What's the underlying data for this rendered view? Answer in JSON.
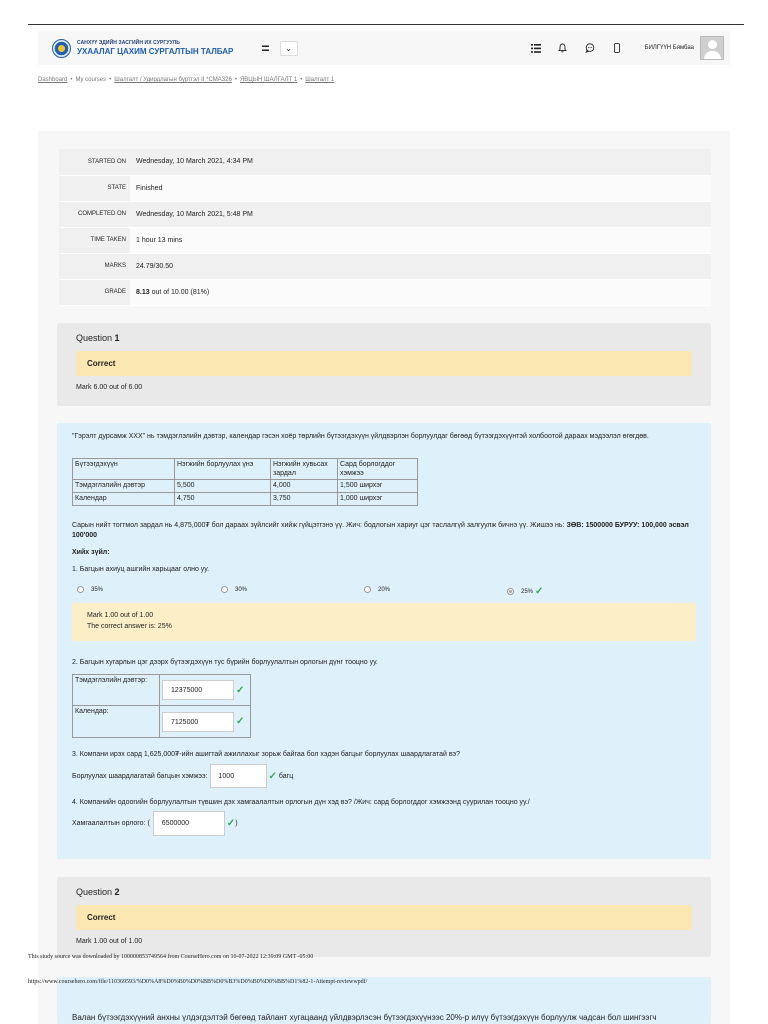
{
  "navbar": {
    "logo_line1": "САНХҮҮ ЭДИЙН ЗАСГИЙН ИХ СУРГУУЛЬ",
    "logo_line2": "УХААЛАГ ЦАХИМ СУРГАЛТЫН ТАЛБАР",
    "menu_symbol": "=",
    "dropdown_symbol": "⌄",
    "user_name": "БИЛГҮҮН Бямбаа"
  },
  "breadcrumb": {
    "items": [
      "Dashboard",
      "My courses",
      "Шалгалт / Удирдлагын бүртгэл II *CMA326",
      "ЯВЦЫН ШАЛГАЛТ 1",
      "Шалгалт 1"
    ],
    "separator": "•"
  },
  "summary": [
    {
      "label": "STARTED ON",
      "value": "Wednesday, 10 March 2021, 4:34 PM"
    },
    {
      "label": "STATE",
      "value": "Finished"
    },
    {
      "label": "COMPLETED ON",
      "value": "Wednesday, 10 March 2021, 5:48 PM"
    },
    {
      "label": "TIME TAKEN",
      "value": "1 hour 13 mins"
    },
    {
      "label": "MARKS",
      "value": "24.79/30.50"
    },
    {
      "label": "GRADE",
      "value_bold": "8.13",
      "value_rest": " out of 10.00 (81%)"
    }
  ],
  "question1": {
    "title_prefix": "Question ",
    "number": "1",
    "state": "Correct",
    "mark": "Mark 6.00 out of 6.00",
    "prompt": "\"Гэрэлт дурсамж XXX\" нь тэмдэглэлийн дэвтэр, календар гэсэн хоёр төрлийн бүтээгдэхүүн үйлдвэрлэн борлуулдаг бөгөөд бүтээгдэхүүнтэй холбоотой дараах мэдээлэл өгөгдөв.",
    "table": {
      "headers": [
        "Бүтээгдэхүүн",
        "Нэгжийн борлуулах үнэ",
        "Нэгжийн хувьсах зардал",
        "Сард борлогддог хэмжээ"
      ],
      "rows": [
        [
          "Тэмдэглэлийн дэвтэр",
          "5,500",
          "4,000",
          "1,500 ширхэг"
        ],
        [
          "Календар",
          "4,750",
          "3,750",
          "1,000 ширхэг"
        ]
      ]
    },
    "note_part1": "Сарын нийт тогтмол зардал нь 4,875,000₮ бол дараах зүйлсийг хийж гүйцэтгэнэ үү. Жич: бодлогын хариуг цэг таслалгүй залгуулж бичнэ үү. Жишээ нь: ",
    "note_bold": "ЗӨВ: 1500000 БУРУУ: 100,000 эсвэл 100'000",
    "instructions": "Хийх зүйл:",
    "sub1": "1.    Багцын ахиуц ашгийн харьцааг олно уу.",
    "options": [
      "35%",
      "30%",
      "20%",
      "25%"
    ],
    "feedback_mark": "Mark 1.00 out of 1.00",
    "feedback_answer": "The correct answer is: 25%",
    "sub2": "2.    Багцын хугарлын цэг дээрх бүтээгдэхүүн тус бүрийн борлуулалтын орлогын дүнг тооцно уу.",
    "answers2": [
      {
        "label": "Тэмдэглэлийн дэвтэр:",
        "value": "12375000"
      },
      {
        "label": "Календар:",
        "value": "7125000"
      }
    ],
    "sub3": "3.    Компани ирэх сард 1,625,000₮-ийн ашигтай ажиллахыг зорьж байгаа бол хэдэн багцыг борлуулах шаардлагатай вэ?",
    "row3_label": "Борлуулах шаардлагатай багцын хэмжээ:",
    "row3_value": "1000",
    "row3_suffix": "багц",
    "sub4": "4.    Компанийн одоогийн борлуулалтын түвшин дэх  хамгаалалтын орлогын дүн хэд вэ? /Жич: сард борлогддог хэмжээнд суурилан тооцно уу./",
    "row4_label": "Хамгаалалтын орлого: (",
    "row4_value": "6500000",
    "row4_suffix": ")"
  },
  "question2": {
    "title_prefix": "Question ",
    "number": "2",
    "state": "Correct",
    "mark": "Mark 1.00 out of 1.00"
  },
  "footer": {
    "source_line": "This study source was downloaded by 100000853749564 from CourseHero.com on 10-07-2022 12:39:09 GMT -05:00",
    "url_line": "https://www.coursehero.com/file/110369593/%D0%A8%D0%B0%D0%BB%D0%B3%D0%B0%D0%BB%D1%82-1-Attempt-reviewwpdf/",
    "next_text": "Валан бүтээгдэхүүний анхны үлдэгдэлтэй бөгөөд тайлант хугацаанд үйлдвэрлэсэн бүтээгдэхүүнээс 20%-р илүү бүтээгдэхүүн борлуулж чадсан бол шингээгч"
  },
  "colors": {
    "state_bg": "#fbe7b1",
    "content_bg": "#def0fa",
    "check": "#32a852",
    "logo_blue": "#1e5fae"
  }
}
